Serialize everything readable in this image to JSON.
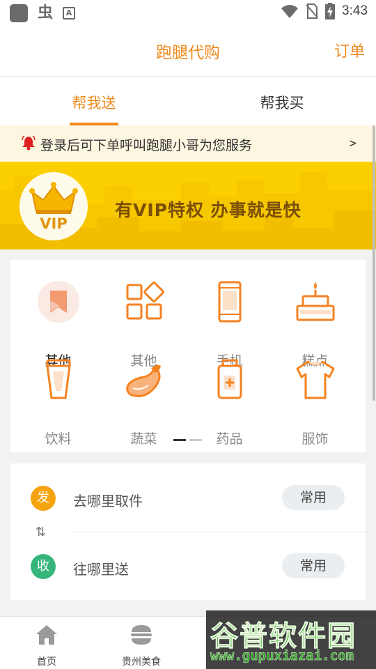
{
  "status_bar": {
    "time": "3:43"
  },
  "header": {
    "title": "跑腿代购",
    "orders_label": "订单"
  },
  "tabs": [
    {
      "label": "帮我送"
    },
    {
      "label": "帮我买"
    }
  ],
  "notice": {
    "text": "登录后可下单呼叫跑腿小哥为您服务",
    "arrow": ">"
  },
  "vip_banner": {
    "badge_text": "VIP",
    "slogan": "有VIP特权  办事就是快"
  },
  "categories": [
    {
      "label": "其他",
      "icon": "bookmark-icon"
    },
    {
      "label": "其他",
      "icon": "grid-icon"
    },
    {
      "label": "手机",
      "icon": "phone-icon"
    },
    {
      "label": "糕点",
      "icon": "cake-icon"
    },
    {
      "label": "饮料",
      "icon": "cup-icon"
    },
    {
      "label": "蔬菜",
      "icon": "eggplant-icon"
    },
    {
      "label": "药品",
      "icon": "medicine-icon"
    },
    {
      "label": "服饰",
      "icon": "shirt-icon"
    }
  ],
  "addresses": {
    "pickup": {
      "badge": "发",
      "label": "去哪里取件",
      "common_btn": "常用"
    },
    "deliver": {
      "badge": "收",
      "label": "往哪里送",
      "common_btn": "常用"
    },
    "swap_icon": "⇅"
  },
  "bottom_nav": [
    {
      "label": "首页",
      "icon": "home-icon"
    },
    {
      "label": "贵州美食",
      "icon": "burger-icon"
    }
  ],
  "watermark": {
    "title": "谷普软件园",
    "url": "www.gupuxiazai.com"
  },
  "colors": {
    "accent": "#ee8a1c",
    "vip_yellow": "#fcd000",
    "send_badge": "#f5a30f",
    "recv_badge": "#36b57a"
  }
}
